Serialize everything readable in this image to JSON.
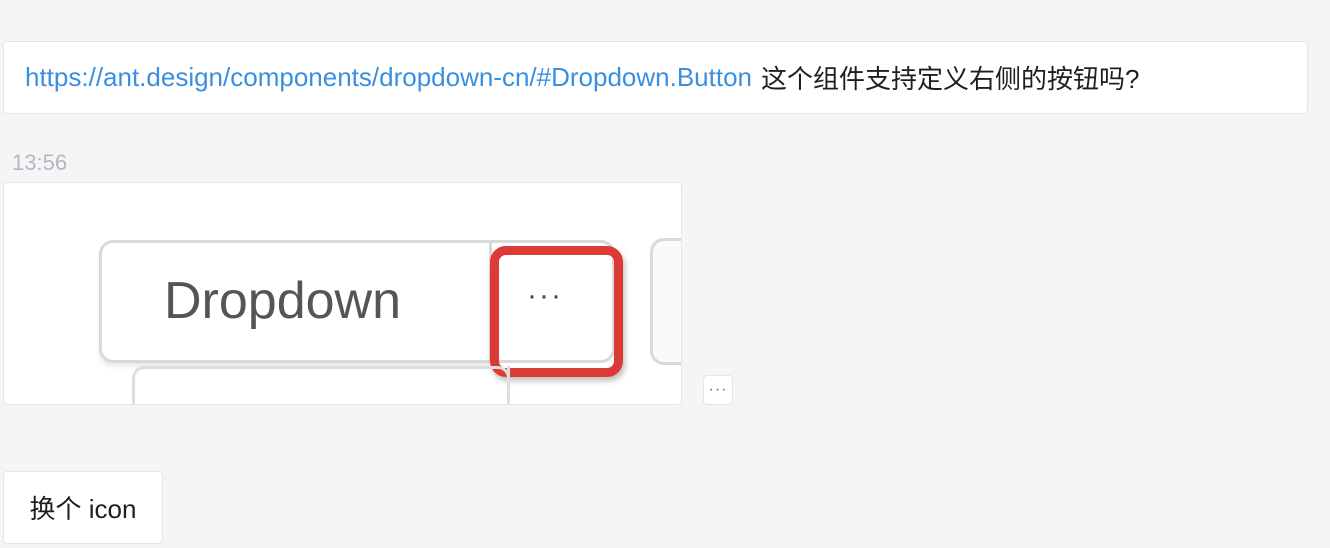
{
  "messages": [
    {
      "link_text": "https://ant.design/components/dropdown-cn/#Dropdown.Button",
      "text": "这个组件支持定义右侧的按钮吗?"
    },
    {
      "text": "换个 icon"
    }
  ],
  "timestamp": "13:56",
  "image_message": {
    "button_label": "Dropdown",
    "ellipsis": "···",
    "highlight_color": "#dc3a36"
  },
  "more_actions": {
    "label": "···",
    "icon": "ellipsis-icon"
  },
  "colors": {
    "link": "#3b8fe0",
    "background": "#f4f5f7",
    "timestamp": "#b4b7bb"
  }
}
